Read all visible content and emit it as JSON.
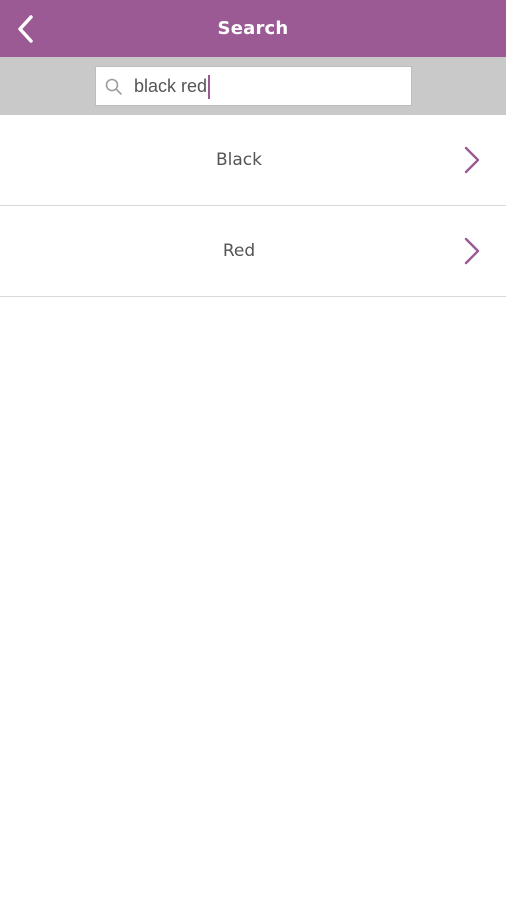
{
  "header": {
    "title": "Search",
    "accent_color": "#9b5a94"
  },
  "search": {
    "value": "black red",
    "icon": "search-icon"
  },
  "results": [
    {
      "label": "Black"
    },
    {
      "label": "Red"
    }
  ]
}
